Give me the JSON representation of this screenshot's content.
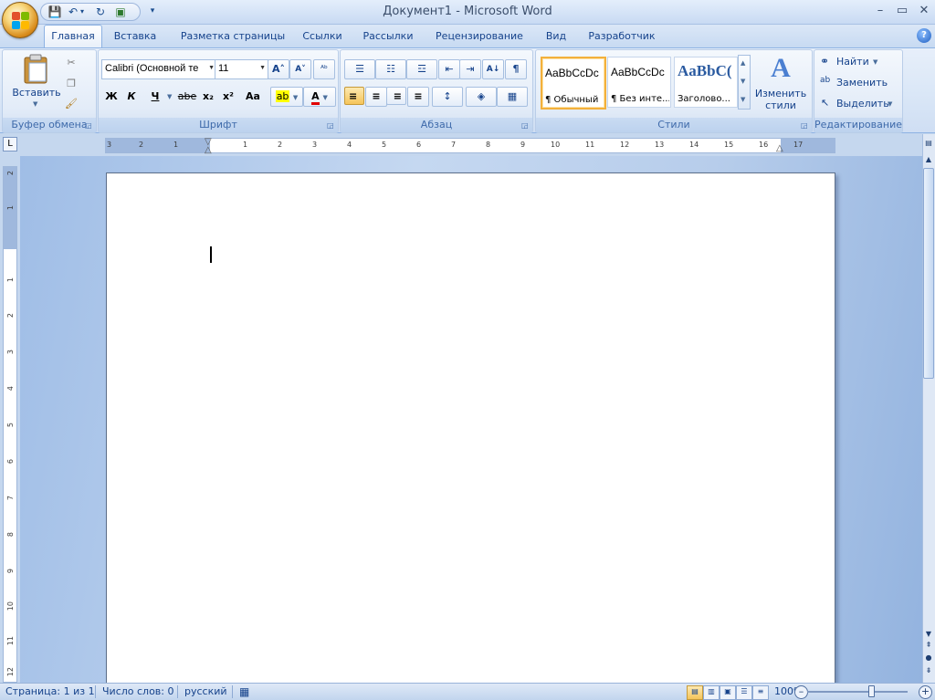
{
  "title_bar": {
    "title": "Документ1 - Microsoft Word",
    "minimize": "–",
    "restore": "▭",
    "close": "✕"
  },
  "quick_access": {
    "save": "💾",
    "undo": "↶",
    "dropdown": "▾",
    "redo": "↻",
    "print_preview": "▣",
    "customize": "▾"
  },
  "tabs": [
    {
      "label": "Главная",
      "active": true
    },
    {
      "label": "Вставка"
    },
    {
      "label": "Разметка страницы"
    },
    {
      "label": "Ссылки"
    },
    {
      "label": "Рассылки"
    },
    {
      "label": "Рецензирование"
    },
    {
      "label": "Вид"
    },
    {
      "label": "Разработчик"
    }
  ],
  "help": "?",
  "groups": {
    "clipboard": {
      "label": "Буфер обмена",
      "paste": "Вставить",
      "cut": "✂",
      "copy": "❐",
      "format_painter": "🖌"
    },
    "font": {
      "label": "Шрифт",
      "font_name": "Calibri (Основной те",
      "font_size": "11",
      "grow": "A˄",
      "shrink": "A˅",
      "clear": "ᴬᵇ",
      "bold": "Ж",
      "italic": "К",
      "underline": "Ч",
      "strike": "abe",
      "subscript": "x₂",
      "superscript": "x²",
      "case": "Aa",
      "highlight": "ab",
      "font_color": "A"
    },
    "paragraph": {
      "label": "Абзац",
      "bullets": "☰",
      "numbering": "☷",
      "multilevel": "☲",
      "decrease_indent": "⇤",
      "increase_indent": "⇥",
      "sort": "A↓",
      "pilcrow": "¶",
      "align_left": "≡",
      "align_center": "≡",
      "align_right": "≡",
      "justify": "≡",
      "line_spacing": "↕",
      "shading": "◈",
      "borders": "▦"
    },
    "styles": {
      "label": "Стили",
      "cards": [
        {
          "sample": "AaBbCcDc",
          "name": "¶ Обычный",
          "selected": true
        },
        {
          "sample": "AaBbCcDc",
          "name": "¶ Без инте..."
        },
        {
          "sample": "AaBbC(",
          "name": "Заголово..."
        }
      ],
      "change_styles": "Изменить стили",
      "change_styles_icon": "A"
    },
    "editing": {
      "label": "Редактирование",
      "find": "Найти",
      "replace": "Заменить",
      "select": "Выделить"
    }
  },
  "ruler": {
    "tab_selector": "L",
    "ticks": [
      "3",
      "2",
      "1",
      "1",
      "2",
      "3",
      "4",
      "5",
      "6",
      "7",
      "8",
      "9",
      "10",
      "11",
      "12",
      "13",
      "14",
      "15",
      "16",
      "17"
    ],
    "vticks": [
      "2",
      "1",
      "1",
      "2",
      "3",
      "4",
      "5",
      "6",
      "7",
      "8",
      "9",
      "10",
      "11",
      "12"
    ]
  },
  "status": {
    "page": "Страница: 1 из 1",
    "words": "Число слов: 0",
    "language": "русский",
    "zoom": "100%",
    "zoom_out": "–",
    "zoom_in": "+"
  }
}
